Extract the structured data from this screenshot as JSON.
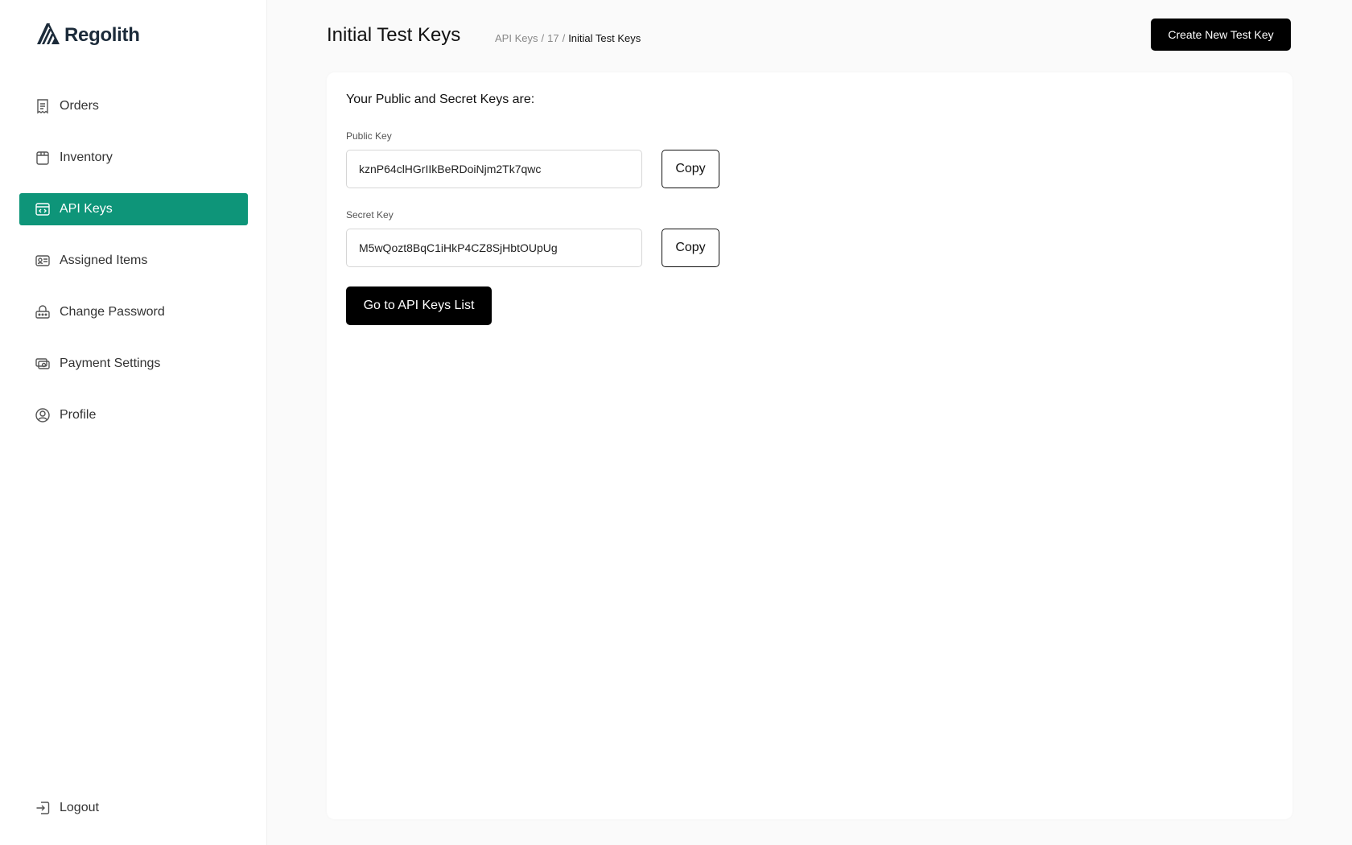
{
  "app": {
    "brand": "Regolith",
    "brand_color": "#1c2b3a",
    "accent": "#0e9579"
  },
  "sidebar": {
    "items": [
      {
        "label": "Orders",
        "icon": "receipt-icon",
        "active": false
      },
      {
        "label": "Inventory",
        "icon": "box-icon",
        "active": false
      },
      {
        "label": "API Keys",
        "icon": "code-card-icon",
        "active": true
      },
      {
        "label": "Assigned Items",
        "icon": "id-card-icon",
        "active": false
      },
      {
        "label": "Change Password",
        "icon": "lock-icon",
        "active": false
      },
      {
        "label": "Payment Settings",
        "icon": "cash-icon",
        "active": false
      },
      {
        "label": "Profile",
        "icon": "user-circle-icon",
        "active": false
      }
    ],
    "logout_label": "Logout"
  },
  "header": {
    "title": "Initial Test Keys",
    "breadcrumb": [
      "API Keys",
      "/",
      "17",
      "/",
      "Initial Test Keys"
    ],
    "create_button": "Create New Test Key"
  },
  "card": {
    "heading": "Your Public and Secret Keys are:",
    "public_key_label": "Public Key",
    "public_key_value": "kznP64clHGrIIkBeRDoiNjm2Tk7qwc",
    "secret_key_label": "Secret Key",
    "secret_key_value": "M5wQozt8BqC1iHkP4CZ8SjHbtOUpUg",
    "copy_label": "Copy",
    "goto_button": "Go to API Keys List"
  }
}
